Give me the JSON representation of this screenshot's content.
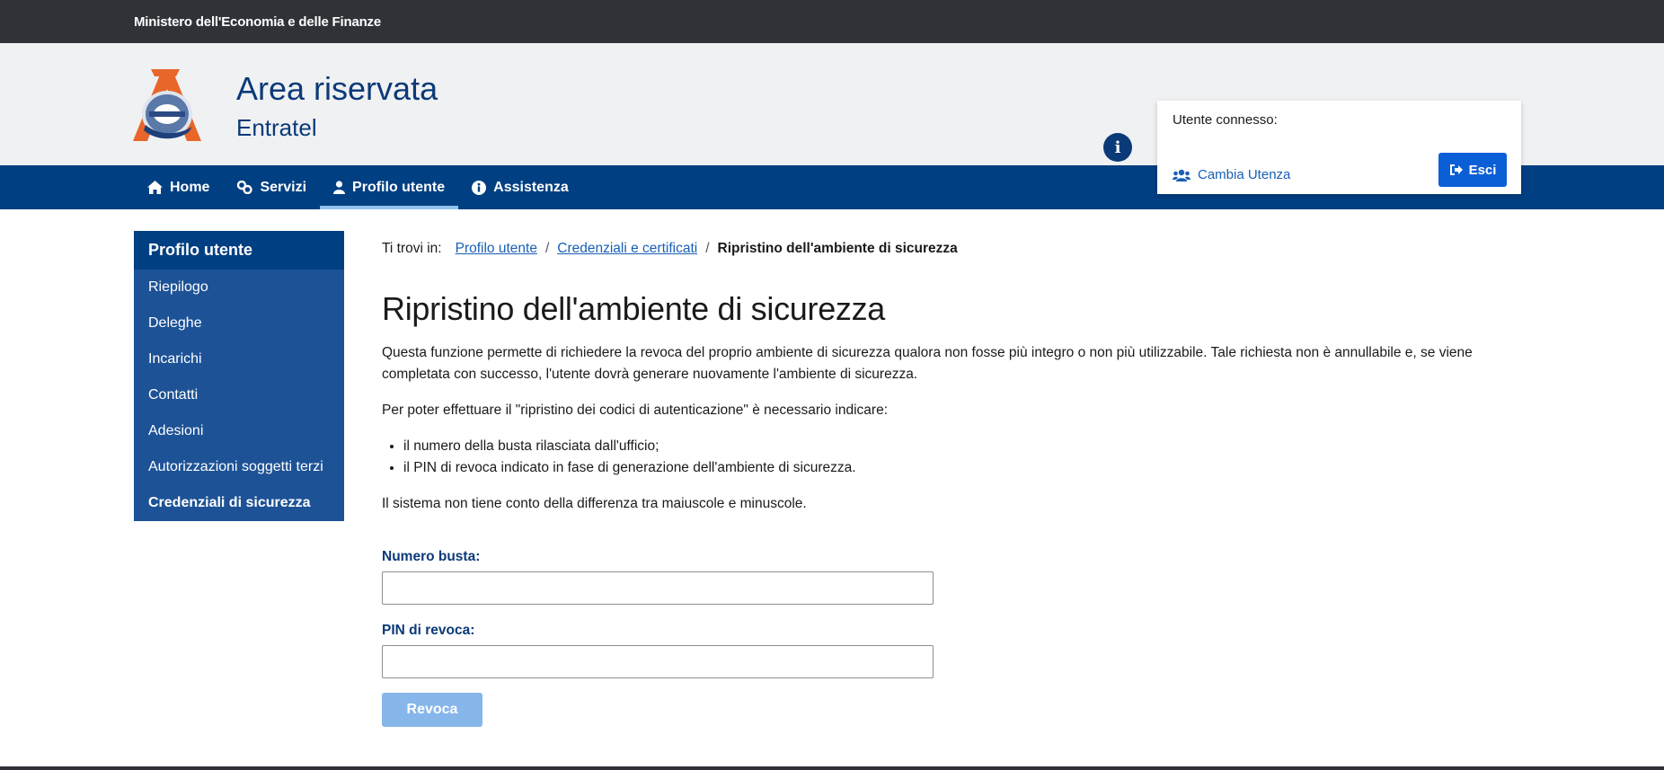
{
  "topbar": {
    "ministry": "Ministero dell'Economia e delle Finanze"
  },
  "header": {
    "title": "Area riservata",
    "subtitle": "Entratel",
    "user_label": "Utente connesso:",
    "switch_user": "Cambia Utenza",
    "logout": "Esci"
  },
  "nav": {
    "items": [
      {
        "label": "Home",
        "icon": "home-icon"
      },
      {
        "label": "Servizi",
        "icon": "services-icon"
      },
      {
        "label": "Profilo utente",
        "icon": "user-icon",
        "active": true
      },
      {
        "label": "Assistenza",
        "icon": "info-icon"
      }
    ]
  },
  "sidebar": {
    "header": "Profilo utente",
    "items": [
      "Riepilogo",
      "Deleghe",
      "Incarichi",
      "Contatti",
      "Adesioni",
      "Autorizzazioni soggetti terzi",
      "Credenziali di sicurezza"
    ],
    "current_index": 6
  },
  "breadcrumb": {
    "prefix": "Ti trovi in:",
    "links": [
      "Profilo utente",
      "Credenziali e certificati"
    ],
    "current": "Ripristino dell'ambiente di sicurezza"
  },
  "main": {
    "title": "Ripristino dell'ambiente di sicurezza",
    "intro": "Questa funzione permette di richiedere la revoca del proprio ambiente di sicurezza qualora non fosse più integro o non più utilizzabile. Tale richiesta non è annullabile e, se viene completata con successo, l'utente dovrà generare nuovamente l'ambiente di sicurezza.",
    "instructions": "Per poter effettuare il \"ripristino dei codici di autenticazione\" è necessario indicare:",
    "bullets": [
      "il numero della busta rilasciata dall'ufficio;",
      "il PIN di revoca indicato in fase di generazione dell'ambiente di sicurezza."
    ],
    "note": "Il sistema non tiene conto della differenza tra maiuscole e minuscole."
  },
  "form": {
    "envelope_label": "Numero busta:",
    "envelope_value": "",
    "pin_label": "PIN di revoca:",
    "pin_value": "",
    "submit": "Revoca"
  },
  "colors": {
    "topbar": "#2f3338",
    "header_bg": "#f0f1f3",
    "brand": "#0b3a78",
    "nav": "#003f82",
    "sidebar": "#1d5296",
    "link": "#1a5fb4",
    "primary_button": "#0b5fd6",
    "disabled_button": "#86b6ea",
    "logo_orange": "#e8662a"
  }
}
